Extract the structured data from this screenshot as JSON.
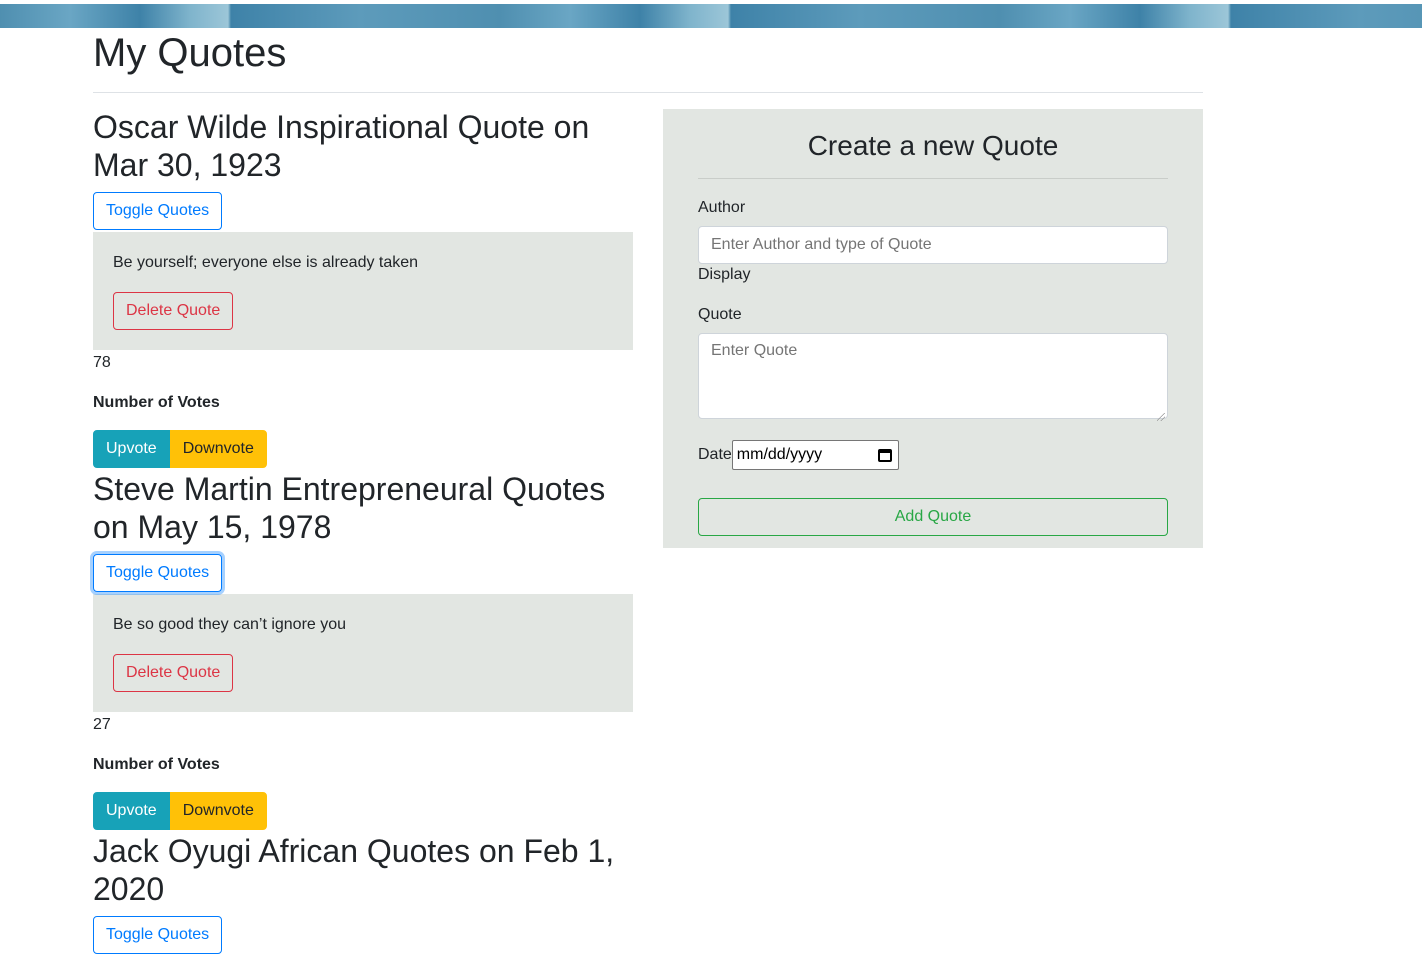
{
  "page": {
    "title": "My Quotes"
  },
  "quotes": [
    {
      "title": "Oscar Wilde Inspirational Quote on Mar 30, 1923",
      "toggle_label": "Toggle Quotes",
      "text": "Be yourself; everyone else is already taken",
      "delete_label": "Delete Quote",
      "votes": "78",
      "votes_label": "Number of Votes",
      "upvote_label": "Upvote",
      "downvote_label": "Downvote"
    },
    {
      "title": "Steve Martin Entrepreneural Quotes on May 15, 1978",
      "toggle_label": "Toggle Quotes",
      "text": "Be so good they can’t ignore you",
      "delete_label": "Delete Quote",
      "votes": "27",
      "votes_label": "Number of Votes",
      "upvote_label": "Upvote",
      "downvote_label": "Downvote"
    },
    {
      "title": "Jack Oyugi African Quotes on Feb 1, 2020",
      "toggle_label": "Toggle Quotes"
    }
  ],
  "form": {
    "title": "Create a new Quote",
    "author_label": "Author",
    "author_placeholder": "Enter Author and type of Quote",
    "display_label": "Display",
    "quote_label": "Quote",
    "quote_placeholder": "Enter Quote",
    "date_label": "Date",
    "date_placeholder": "mm/dd/yyyy",
    "submit_label": "Add Quote"
  }
}
